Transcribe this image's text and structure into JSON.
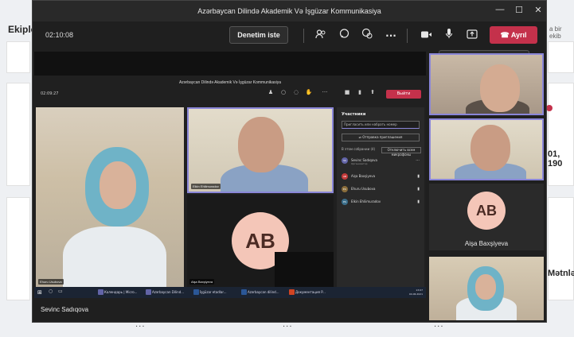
{
  "background_app": {
    "title": "Ekiple",
    "right_link": "a bir ekib",
    "right_text_1": "01, 190",
    "right_text_2": "Mətnlər"
  },
  "window": {
    "title": "Azərbaycan Dilində Akademik Və İşgüzar Kommunikasiya",
    "controls": {
      "minimize": "—",
      "maximize": "☐",
      "close": "✕"
    }
  },
  "toolbar": {
    "timer": "02:10:08",
    "control_button": "Denetim iste",
    "leave_button": "Ayrıl",
    "icons": [
      "people-icon",
      "chat-icon",
      "reactions-icon",
      "more-icon",
      "camera-icon",
      "mic-icon",
      "share-icon",
      "phone-icon"
    ]
  },
  "tooltip": "Sessize al (Ctrl+Shift+M)",
  "stage": {
    "presenter_name": "Sevinc Sadıqova",
    "shared_screen": {
      "title": "Azərbaycan Dilində Akademik Və İşgüzar Kommunikasiya",
      "timer": "02:09:27",
      "leave": "Выйти",
      "video1_name": "Ehuru Usubova",
      "video2_name": "Elkin Ehliimuradov",
      "video3_avatar": "AB",
      "video3_name": "Aişa Baxşiyeva",
      "panel": {
        "title": "Участники",
        "search_placeholder": "Пригласить или набрать номер",
        "invite_button": "Отправка приглашения",
        "section": "В этом собрании (4)",
        "mute_all": "Отключить всем микрофоны",
        "participants": [
          {
            "initials": "SS",
            "name": "Sevinc Sadıqova",
            "role": "Организатор",
            "color": "#6264a7"
          },
          {
            "initials": "AB",
            "name": "Aişa Baxşiyeva",
            "role": "",
            "color": "#c43b3b"
          },
          {
            "initials": "EU",
            "name": "Ehuru Usubova",
            "role": "",
            "color": "#8a6d3b"
          },
          {
            "initials": "ES",
            "name": "Elkin Ehliimuradov",
            "role": "",
            "color": "#3b6e8a"
          }
        ]
      },
      "taskbar": {
        "items": [
          "Календарь | Micro...",
          "Azərbaycan Dilind...",
          "İşgüzar etadlar...",
          "Azərbaycan dilind...",
          "Документация P..."
        ],
        "time": "13:07",
        "date": "04.06.2021"
      }
    }
  },
  "gallery": {
    "avatar_initials": "AB",
    "avatar_name": "Aişa Baxşiyeva"
  }
}
